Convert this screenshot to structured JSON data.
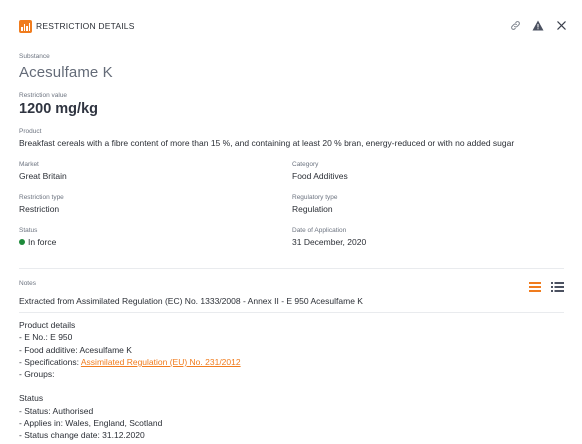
{
  "header": {
    "title": "RESTRICTION DETAILS",
    "icons": [
      "chart-icon",
      "link-icon",
      "warning-icon",
      "close-icon"
    ],
    "accent_color": "#f07c1e"
  },
  "substance": {
    "label": "Substance",
    "value": "Acesulfame K"
  },
  "restriction_value": {
    "label": "Restriction value",
    "value": "1200 mg/kg"
  },
  "product": {
    "label": "Product",
    "value": "Breakfast cereals with a fibre content of more than 15 %, and containing at least 20 % bran, energy-reduced or with no added sugar"
  },
  "fields": {
    "market": {
      "label": "Market",
      "value": "Great Britain"
    },
    "category": {
      "label": "Category",
      "value": "Food Additives"
    },
    "restriction_type": {
      "label": "Restriction type",
      "value": "Restriction"
    },
    "regulatory_type": {
      "label": "Regulatory type",
      "value": "Regulation"
    },
    "status": {
      "label": "Status",
      "value": "In force",
      "color": "#1d8a3a"
    },
    "date_of_application": {
      "label": "Date of Application",
      "value": "31 December, 2020"
    }
  },
  "notes": {
    "label": "Notes",
    "text": "Extracted from Assimilated Regulation (EC) No. 1333/2008 - Annex II - E 950 Acesulfame K",
    "views": [
      "compact-view-icon",
      "list-view-icon"
    ]
  },
  "details": {
    "product_details_title": "Product details",
    "e_no": "- E No.: E 950",
    "food_additive": "- Food additive: Acesulfame K",
    "specifications_prefix": "- Specifications: ",
    "specifications_link": "Assimilated Regulation (EU) No. 231/2012",
    "groups": "- Groups:",
    "status_title": "Status",
    "status_line": "- Status: Authorised",
    "applies_in": "- Applies in: Wales, England, Scotland",
    "status_change": "- Status change date: 31.12.2020"
  }
}
